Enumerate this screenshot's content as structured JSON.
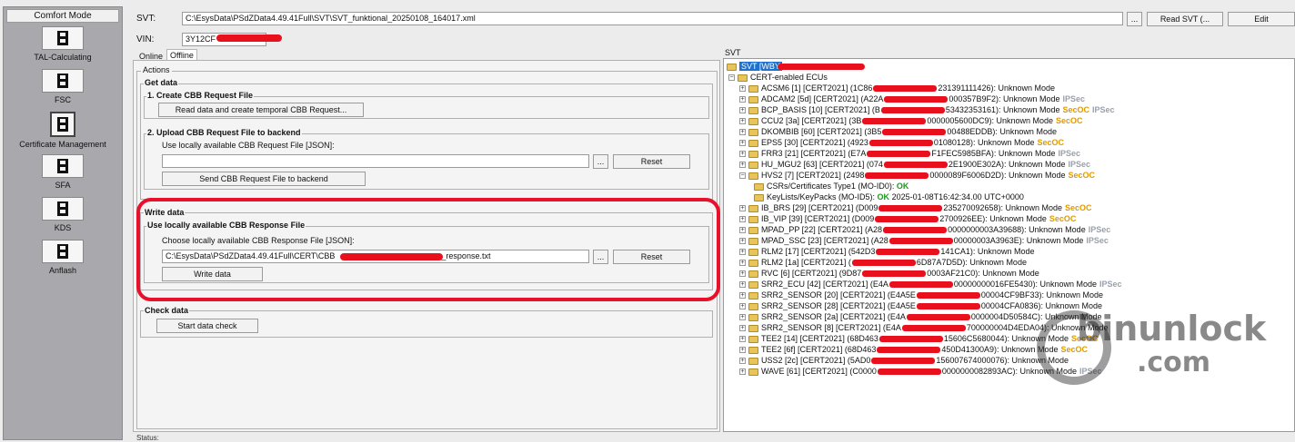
{
  "sidebar": {
    "header": "Comfort Mode",
    "items": [
      {
        "label": "TAL-Calculating",
        "icon": "module-icon",
        "active": false
      },
      {
        "label": "FSC",
        "icon": "module-icon",
        "active": false
      },
      {
        "label": "Certificate Management",
        "icon": "module-icon",
        "active": true
      },
      {
        "label": "SFA",
        "icon": "module-icon",
        "active": false
      },
      {
        "label": "KDS",
        "icon": "module-icon",
        "active": false
      },
      {
        "label": "Anflash",
        "icon": "module-icon",
        "active": false
      }
    ]
  },
  "top": {
    "svt_label": "SVT:",
    "svt_value": "C:\\EsysData\\PSdZData4.49.41Full\\SVT\\SVT_funktional_20250108_164017.xml",
    "browse_label": "...",
    "read_svt_label": "Read SVT (...",
    "edit_label": "Edit",
    "vin_label": "VIN:",
    "vin_value": "3Y12CF"
  },
  "tabs": {
    "online": "Online",
    "offline": "Offline"
  },
  "actions": {
    "group": "Actions",
    "get_data": "Get data",
    "create_title": "1. Create CBB Request File",
    "create_button": "Read data and create temporal CBB Request...",
    "upload_title": "2. Upload CBB Request File to backend",
    "upload_hint": "Use locally available CBB Request File [JSON]:",
    "upload_value": "",
    "upload_browse": "...",
    "upload_reset": "Reset",
    "send_button": "Send CBB Request File to backend",
    "write_data": "Write data",
    "response_title": "Use locally available CBB Response File",
    "response_hint": "Choose locally available CBB Response File [JSON]:",
    "response_value_prefix": "C:\\EsysData\\PSdZData4.49.41Full\\CERT\\CBB",
    "response_value_suffix": "_response.txt",
    "response_browse": "...",
    "response_reset": "Reset",
    "write_button": "Write data",
    "check_data": "Check data",
    "check_button": "Start data check",
    "status": "Status:"
  },
  "tree": {
    "title": "SVT",
    "root": "SVT [WBY",
    "group": "CERT-enabled ECUs",
    "rows": [
      {
        "name": "ACSM6 [1] [CERT2021] (1C86",
        "tail": "231391111426): Unknown Mode",
        "tags": []
      },
      {
        "name": "ADCAM2 [5d] [CERT2021] (A22A",
        "tail": "000357B9F2): Unknown Mode",
        "tags": [
          "IPSec"
        ]
      },
      {
        "name": "BCP_BASIS [10] [CERT2021] (B",
        "tail": "53432353161): Unknown Mode",
        "tags": [
          "SecOC",
          "IPSec"
        ]
      },
      {
        "name": "CCU2 [3a] [CERT2021] (3B",
        "tail": "0000005600DC9): Unknown Mode",
        "tags": [
          "SecOC"
        ]
      },
      {
        "name": "DKOMBIB [60] [CERT2021] (3B5",
        "tail": "00488EDDB): Unknown Mode",
        "tags": []
      },
      {
        "name": "EPS5 [30] [CERT2021] (4923",
        "tail": "01080128): Unknown Mode",
        "tags": [
          "SecOC"
        ]
      },
      {
        "name": "FRR3 [21] [CERT2021] (E7A",
        "tail": "F1FEC5985BFA): Unknown Mode",
        "tags": [
          "IPSec"
        ]
      },
      {
        "name": "HU_MGU2 [63] [CERT2021] (074",
        "tail": "2E1900E302A): Unknown Mode",
        "tags": [
          "IPSec"
        ]
      },
      {
        "name": "HVS2 [7] [CERT2021] (2498",
        "tail": "0000089F6006D2D): Unknown Mode",
        "tags": [
          "SecOC"
        ]
      },
      {
        "name": "IB_BRS [29] [CERT2021] (D009",
        "tail": "235270092658): Unknown Mode",
        "tags": [
          "SecOC"
        ]
      },
      {
        "name": "IB_VIP [39] [CERT2021] (D009",
        "tail": "2700926EE): Unknown Mode",
        "tags": [
          "SecOC"
        ]
      },
      {
        "name": "MPAD_PP [22] [CERT2021] (A28",
        "tail": "0000000003A39688): Unknown Mode",
        "tags": [
          "IPSec"
        ]
      },
      {
        "name": "MPAD_SSC [23] [CERT2021] (A28",
        "tail": "00000003A3963E): Unknown Mode",
        "tags": [
          "IPSec"
        ]
      },
      {
        "name": "RLM2 [17] [CERT2021] (542D3",
        "tail": "141CA1): Unknown Mode",
        "tags": []
      },
      {
        "name": "RLM2 [1a] [CERT2021] (",
        "tail": "6D87A7D5D): Unknown Mode",
        "tags": []
      },
      {
        "name": "RVC [6] [CERT2021] (9D87",
        "tail": "0003AF21C0): Unknown Mode",
        "tags": []
      },
      {
        "name": "SRR2_ECU [42] [CERT2021] (E4A",
        "tail": "00000000016FE5430): Unknown Mode",
        "tags": [
          "IPSec"
        ]
      },
      {
        "name": "SRR2_SENSOR [20] [CERT2021] (E4A5E",
        "tail": "00004CF9BF33): Unknown Mode",
        "tags": []
      },
      {
        "name": "SRR2_SENSOR [28] [CERT2021] (E4A5E",
        "tail": "00004CFA0836): Unknown Mode",
        "tags": []
      },
      {
        "name": "SRR2_SENSOR [2a] [CERT2021] (E4A",
        "tail": "0000004D50584C): Unknown Mode",
        "tags": []
      },
      {
        "name": "SRR2_SENSOR [8] [CERT2021] (E4A",
        "tail": "700000004D4EDA04): Unknown Mode",
        "tags": []
      },
      {
        "name": "TEE2 [14] [CERT2021] (68D463",
        "tail": "15606C5680044): Unknown Mode",
        "tags": [
          "SecOC"
        ]
      },
      {
        "name": "TEE2 [6f] [CERT2021] (68D463",
        "tail": "450D41300A9): Unknown Mode",
        "tags": [
          "SecOC"
        ]
      },
      {
        "name": "USS2 [2c] [CERT2021] (5AD0",
        "tail": "156007674000076): Unknown Mode",
        "tags": []
      },
      {
        "name": "WAVE [61] [CERT2021] (C0000",
        "tail": "0000000082893AC): Unknown Mode",
        "tags": [
          "IPSec"
        ]
      }
    ],
    "hvs_children": [
      {
        "label": "CSRs/Certificates Type1 (MO-ID0):",
        "status": "OK",
        "extra": ""
      },
      {
        "label": "KeyLists/KeyPacks (MO-ID5):",
        "status": "OK",
        "extra": "2025-01-08T16:42:34.00 UTC+0000"
      }
    ]
  },
  "watermark": {
    "line1": "binunlock",
    "line2": ".com"
  },
  "colors": {
    "selection": "#1d72d0",
    "ok": "#1a9a1a",
    "secoc": "#e09a00",
    "ipsec": "#9aa0aa",
    "redaction": "#e8101c",
    "highlight": "#e8102a"
  }
}
